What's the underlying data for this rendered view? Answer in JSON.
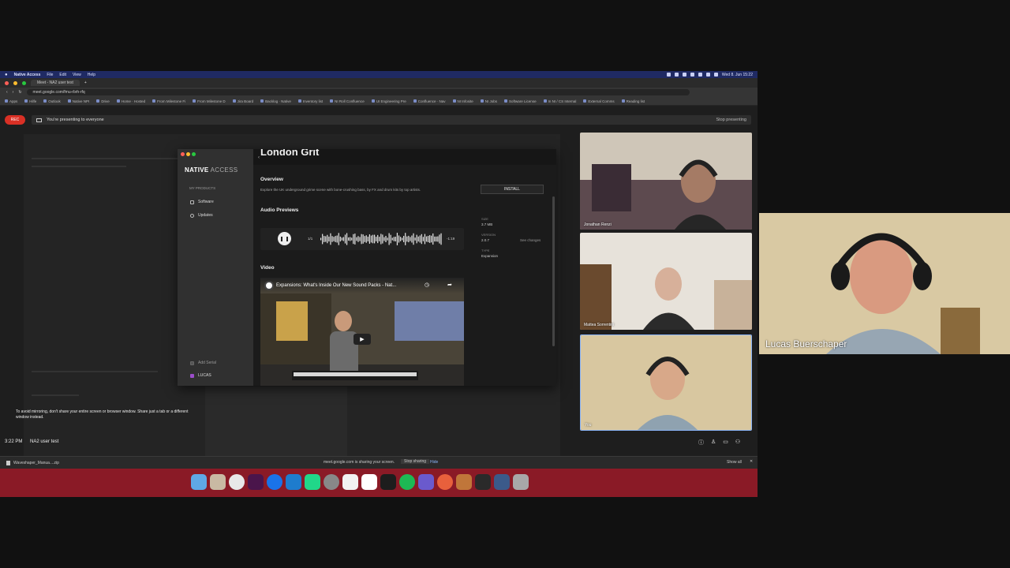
{
  "menubar": {
    "app": "Native Access",
    "menus": [
      "File",
      "Edit",
      "View",
      "Help"
    ],
    "clock": "Wed 8. Jun  15:22"
  },
  "browser": {
    "tab_title": "Meet - NA2 user test",
    "url": "meet.google.com/fmu-rbrh-rfq",
    "bookmarks": [
      "Apps",
      "Hilfe",
      "Outlook",
      "Native NPI",
      "Drive",
      "Home · Hosted",
      "From Milestone Fi",
      "From Milestone D",
      "Jira Board",
      "Backlog · Native",
      "Inventory list",
      "NI Roll Confluence",
      "UI Engineering Pre",
      "Confluence · Nav",
      "NI Infosite",
      "NI Jobs",
      "Software License",
      "In NI / CS Internal",
      "External Comms",
      "Reading list"
    ]
  },
  "meet": {
    "rec_label": "REC",
    "presenting_text": "You're presenting to everyone",
    "stop_label": "Stop presenting",
    "warning_text": "To avoid mirroring, don't share your entire screen or browser window. Share just a tab or a different window instead.",
    "time": "3:22 PM",
    "meeting_name": "NA2 user test"
  },
  "native_access": {
    "brand_bold": "NATIVE",
    "brand_light": "ACCESS",
    "section": "MY PRODUCTS",
    "nav": [
      "Software",
      "Updates"
    ],
    "add_serial": "Add Serial",
    "user": "LUCAS",
    "product_title": "London Grit",
    "overview_heading": "Overview",
    "overview_text": "Explore the UK underground grime scene with bone-crushing bass, by FX and drum kits by top artists.",
    "install_label": "INSTALL",
    "audio_heading": "Audio Previews",
    "track_counter": "1/1",
    "track_time": "-1:19",
    "video_heading": "Video",
    "video_title": "Expansions: What's Inside Our New Sound Packs - Nat...",
    "meta": [
      {
        "label": "SIZE",
        "value": "3.7 MB"
      },
      {
        "label": "VERSION",
        "value": "2.0.7"
      },
      {
        "label": "TYPE",
        "value": "Expansion"
      }
    ],
    "see_changes": "See changes"
  },
  "participants": {
    "top": "Jonathan Renzi",
    "middle": "Mattea Sorrentini",
    "bottom": "You",
    "featured": "Lucas Buerschaper"
  },
  "footer": {
    "download_file": "Waveshaper_Manua....zip",
    "share_notice": "meet.google.com is sharing your screen.",
    "stop_sharing": "Stop sharing",
    "hide": "Hide",
    "show_all": "Show all"
  },
  "colors": {
    "rec": "#d93025",
    "menubar": "#1f2a63",
    "dock_strip": "#8a1a26"
  }
}
